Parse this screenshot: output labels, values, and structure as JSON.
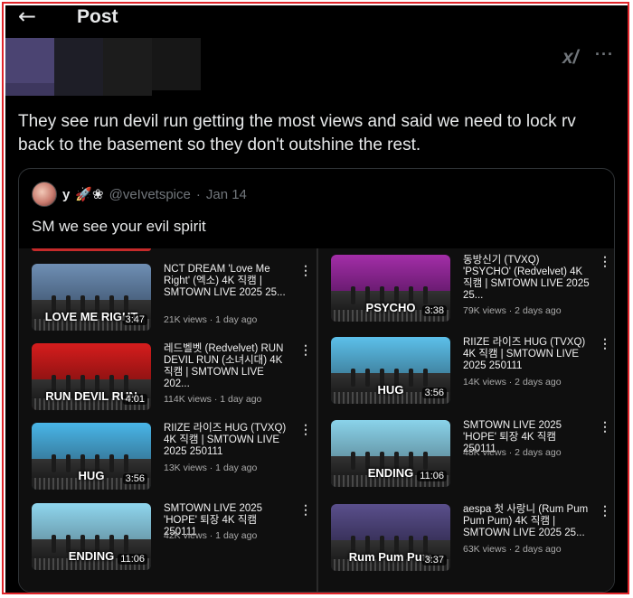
{
  "header": {
    "back_icon": "back-arrow-icon",
    "title": "Post"
  },
  "post": {
    "text": "They see run devil run getting the most views and said we need to lock rv back to the basement so they don't outshine the rest.",
    "grok_label": "x/",
    "more_label": "···"
  },
  "quote": {
    "name": "y",
    "emojis": "🚀❀",
    "handle": "@veIvetspice",
    "dot": "·",
    "date": "Jan 14",
    "text": "SM we see your evil spirit"
  },
  "videos_left": [
    {
      "overlay": "LOVE ME RIGHT",
      "duration": "3:47",
      "title": "NCT DREAM 'Love Me Right' (엑소) 4K 직캠 | SMTOWN LIVE 2025 25...",
      "meta": "21K views · 1 day ago",
      "colors": [
        "#6f8fb4",
        "#2c3e55"
      ]
    },
    {
      "overlay": "RUN DEVIL RUN",
      "duration": "4:01",
      "title": "레드벨벳 (Redvelvet) RUN DEVIL RUN (소녀시대) 4K 직캠 | SMTOWN LIVE 202...",
      "meta": "114K views · 1 day ago",
      "colors": [
        "#d61d1d",
        "#5a0a0a"
      ]
    },
    {
      "overlay": "HUG",
      "duration": "3:56",
      "title": "RIIZE 라이즈 HUG (TVXQ) 4K 직캠 | SMTOWN LIVE 2025 250111",
      "meta": "13K views · 1 day ago",
      "colors": [
        "#49b6e8",
        "#2a4f65"
      ]
    },
    {
      "overlay": "ENDING",
      "duration": "11:06",
      "title": "SMTOWN LIVE 2025 'HOPE' 퇴장 4K 직캠 250111",
      "meta": "42K views · 1 day ago",
      "colors": [
        "#8fd6ee",
        "#50707c"
      ]
    }
  ],
  "videos_right": [
    {
      "overlay": "PSYCHO",
      "duration": "3:38",
      "title": "동방신기 (TVXQ) 'PSYCHO' (Redvelvet) 4K 직캠 | SMTOWN LIVE 2025 25...",
      "meta": "79K views · 2 days ago",
      "colors": [
        "#a32ea8",
        "#3c0c45"
      ]
    },
    {
      "overlay": "HUG",
      "duration": "3:56",
      "title": "RIIZE 라이즈 HUG (TVXQ) 4K 직캠 | SMTOWN LIVE 2025 250111",
      "meta": "14K views · 2 days ago",
      "colors": [
        "#5cc0ea",
        "#2b5468"
      ]
    },
    {
      "overlay": "ENDING",
      "duration": "11:06",
      "title": "SMTOWN LIVE 2025 'HOPE' 퇴장 4K 직캠 250111",
      "meta": "48K views · 2 days ago",
      "colors": [
        "#8ad3ea",
        "#4b6b77"
      ]
    },
    {
      "overlay": "Rum Pum Pum",
      "duration": "3:37",
      "title": "aespa 첫 사랑니 (Rum Pum Pum Pum) 4K 직캠 | SMTOWN LIVE 2025 25...",
      "meta": "63K views · 2 days ago",
      "colors": [
        "#5a4f8c",
        "#1e1a33"
      ]
    }
  ],
  "more_video_label": "⋮"
}
